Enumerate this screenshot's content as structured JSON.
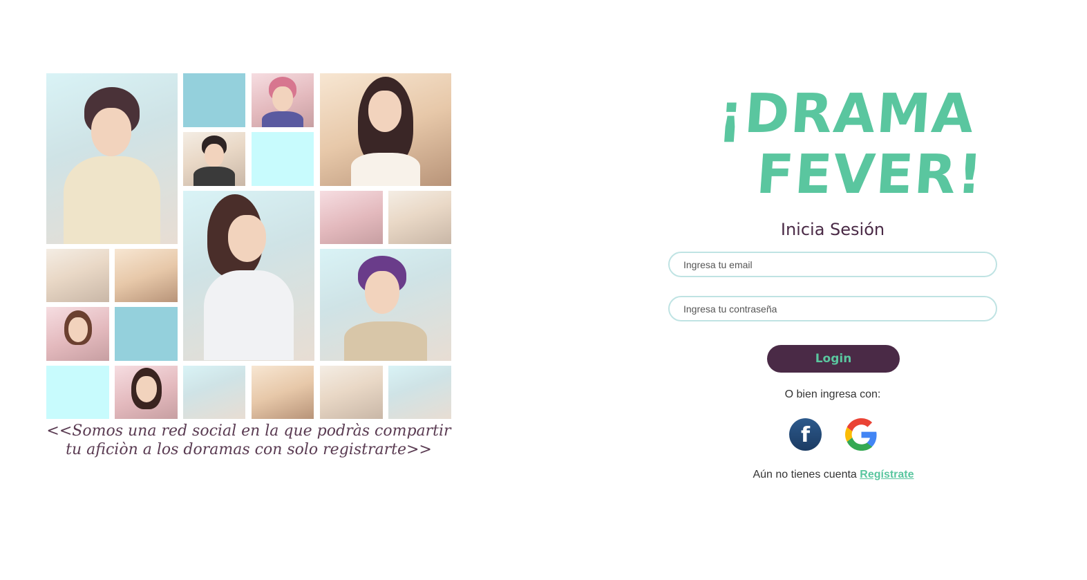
{
  "promo": {
    "caption_line1": "<<Somos una red social en la que podràs compartir",
    "caption_line2": "tu aficiòn a los doramas con solo registrarte>>"
  },
  "brand": {
    "line1": "¡DRAMA",
    "line2": "FEVER!",
    "color": "#5ac69f"
  },
  "login": {
    "heading": "Inicia Sesión",
    "email_placeholder": "Ingresa tu email",
    "password_placeholder": "Ingresa tu contraseña",
    "submit_label": "Login",
    "alt_text": "O bien ingresa con:",
    "social": [
      "facebook-icon",
      "google-icon"
    ],
    "register_prompt": "Aún no tienes cuenta",
    "register_link": "Regístrate",
    "button_color": "#4a2a46"
  }
}
